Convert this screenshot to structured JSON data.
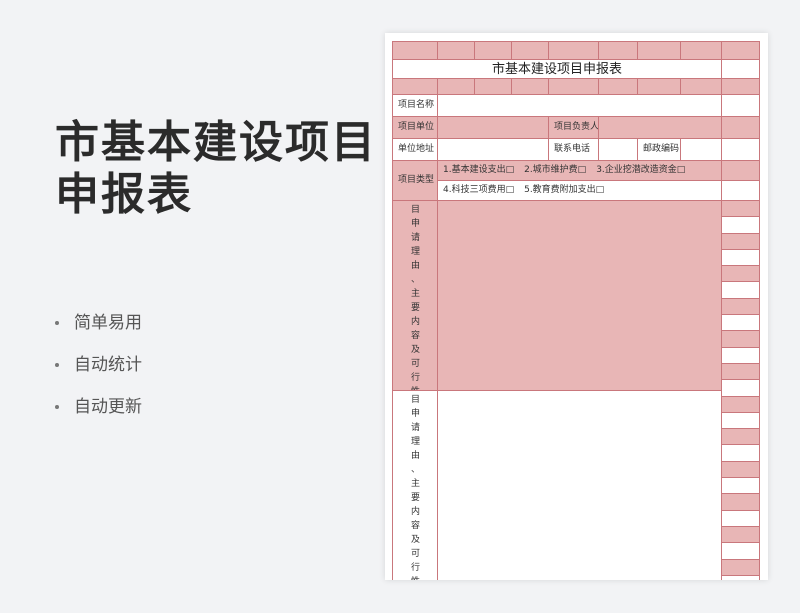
{
  "promo": {
    "title_line1": "市基本建设项目",
    "title_line2": "申报表",
    "features": [
      "简单易用",
      "自动统计",
      "自动更新"
    ]
  },
  "sheet": {
    "title": "市基本建设项目申报表",
    "labels": {
      "project_name": "项目名称",
      "project_unit": "项目单位",
      "project_leader": "项目负责人",
      "unit_address": "单位地址",
      "contact_phone": "联系电话",
      "postal_code": "邮政编码",
      "project_type": "项目类型"
    },
    "project_types_row1": [
      "1.基本建设支出□",
      "2.城市维护费□",
      "3.企业挖潜改造资金□"
    ],
    "project_types_row2": [
      "4.科技三项费用□",
      "5.教育费附加支出□"
    ],
    "reason_label_1": "目申请理由、主要内容及可行性情",
    "reason_label_2": "目申请理由、主要内容及可行性"
  },
  "colors": {
    "pink": "#e8b6b6",
    "border": "#c9777c",
    "page_bg": "#f2f3f5"
  }
}
